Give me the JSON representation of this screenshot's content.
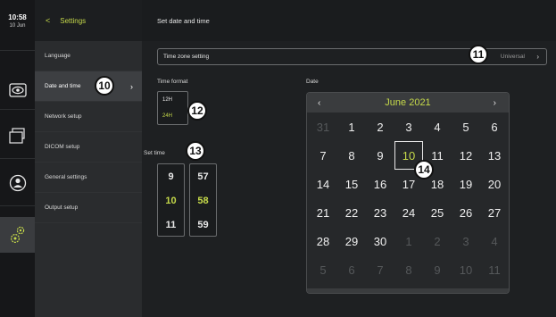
{
  "status": {
    "time": "10:58",
    "date": "10 Jun"
  },
  "rail": {
    "items": [
      {
        "icon": "eye-icon"
      },
      {
        "icon": "folder-icon"
      },
      {
        "icon": "user-icon"
      },
      {
        "icon": "gears-icon"
      }
    ]
  },
  "menu": {
    "back_label": "Settings",
    "items": [
      {
        "label": "Language"
      },
      {
        "label": "Date and time"
      },
      {
        "label": "Network setup"
      },
      {
        "label": "DICOM setup"
      },
      {
        "label": "General settings"
      },
      {
        "label": "Output setup"
      }
    ]
  },
  "main": {
    "title": "Set date and time",
    "timezone": {
      "label": "Time zone setting",
      "value": "Universal"
    },
    "time_format": {
      "label": "Time format",
      "options": [
        "12H",
        "24H"
      ],
      "selected": "24H"
    },
    "set_time": {
      "label": "Set time",
      "hours": [
        "9",
        "10",
        "11"
      ],
      "minutes": [
        "57",
        "58",
        "59"
      ]
    },
    "date": {
      "label": "Date",
      "month_title": "June 2021",
      "prev": "‹",
      "next": "›",
      "weeks": [
        [
          "31",
          "1",
          "2",
          "3",
          "4",
          "5",
          "6"
        ],
        [
          "7",
          "8",
          "9",
          "10",
          "11",
          "12",
          "13"
        ],
        [
          "14",
          "15",
          "16",
          "17",
          "18",
          "19",
          "20"
        ],
        [
          "21",
          "22",
          "23",
          "24",
          "25",
          "26",
          "27"
        ],
        [
          "28",
          "29",
          "30",
          "1",
          "2",
          "3",
          "4"
        ],
        [
          "5",
          "6",
          "7",
          "8",
          "9",
          "10",
          "11"
        ]
      ],
      "today": "10"
    }
  },
  "callouts": [
    "10",
    "11",
    "12",
    "13",
    "14"
  ],
  "colors": {
    "accent": "#c6da4a",
    "background": "#1e2022",
    "rail": "#161719"
  }
}
